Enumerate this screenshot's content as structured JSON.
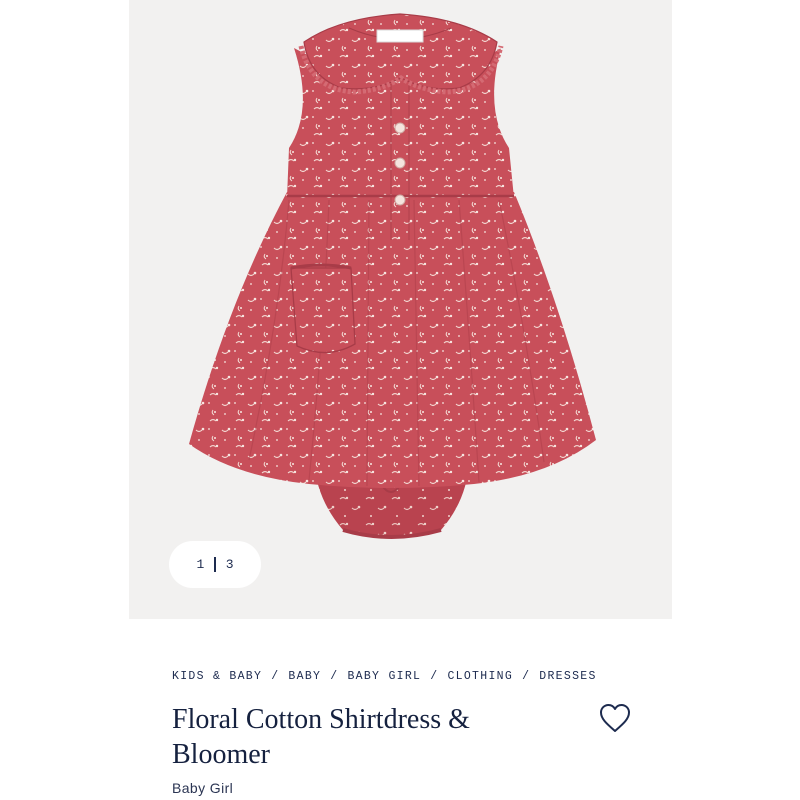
{
  "gallery": {
    "image_alt": "Floral Cotton Shirtdress & Bloomer",
    "current_page": "1",
    "total_pages": "3",
    "colors": {
      "background": "#f2f1f0",
      "dress": "#c84f5a",
      "print": "#f3d9d3"
    }
  },
  "breadcrumb": [
    "KIDS & BABY",
    "BABY",
    "BABY GIRL",
    "CLOTHING",
    "DRESSES"
  ],
  "product": {
    "title": "Floral Cotton Shirtdress & Bloomer",
    "subtitle": "Baby Girl"
  },
  "icons": {
    "favorite": "heart-outline-icon"
  },
  "colors": {
    "text_primary": "#15213f",
    "text_nav": "#1d2b4f"
  }
}
